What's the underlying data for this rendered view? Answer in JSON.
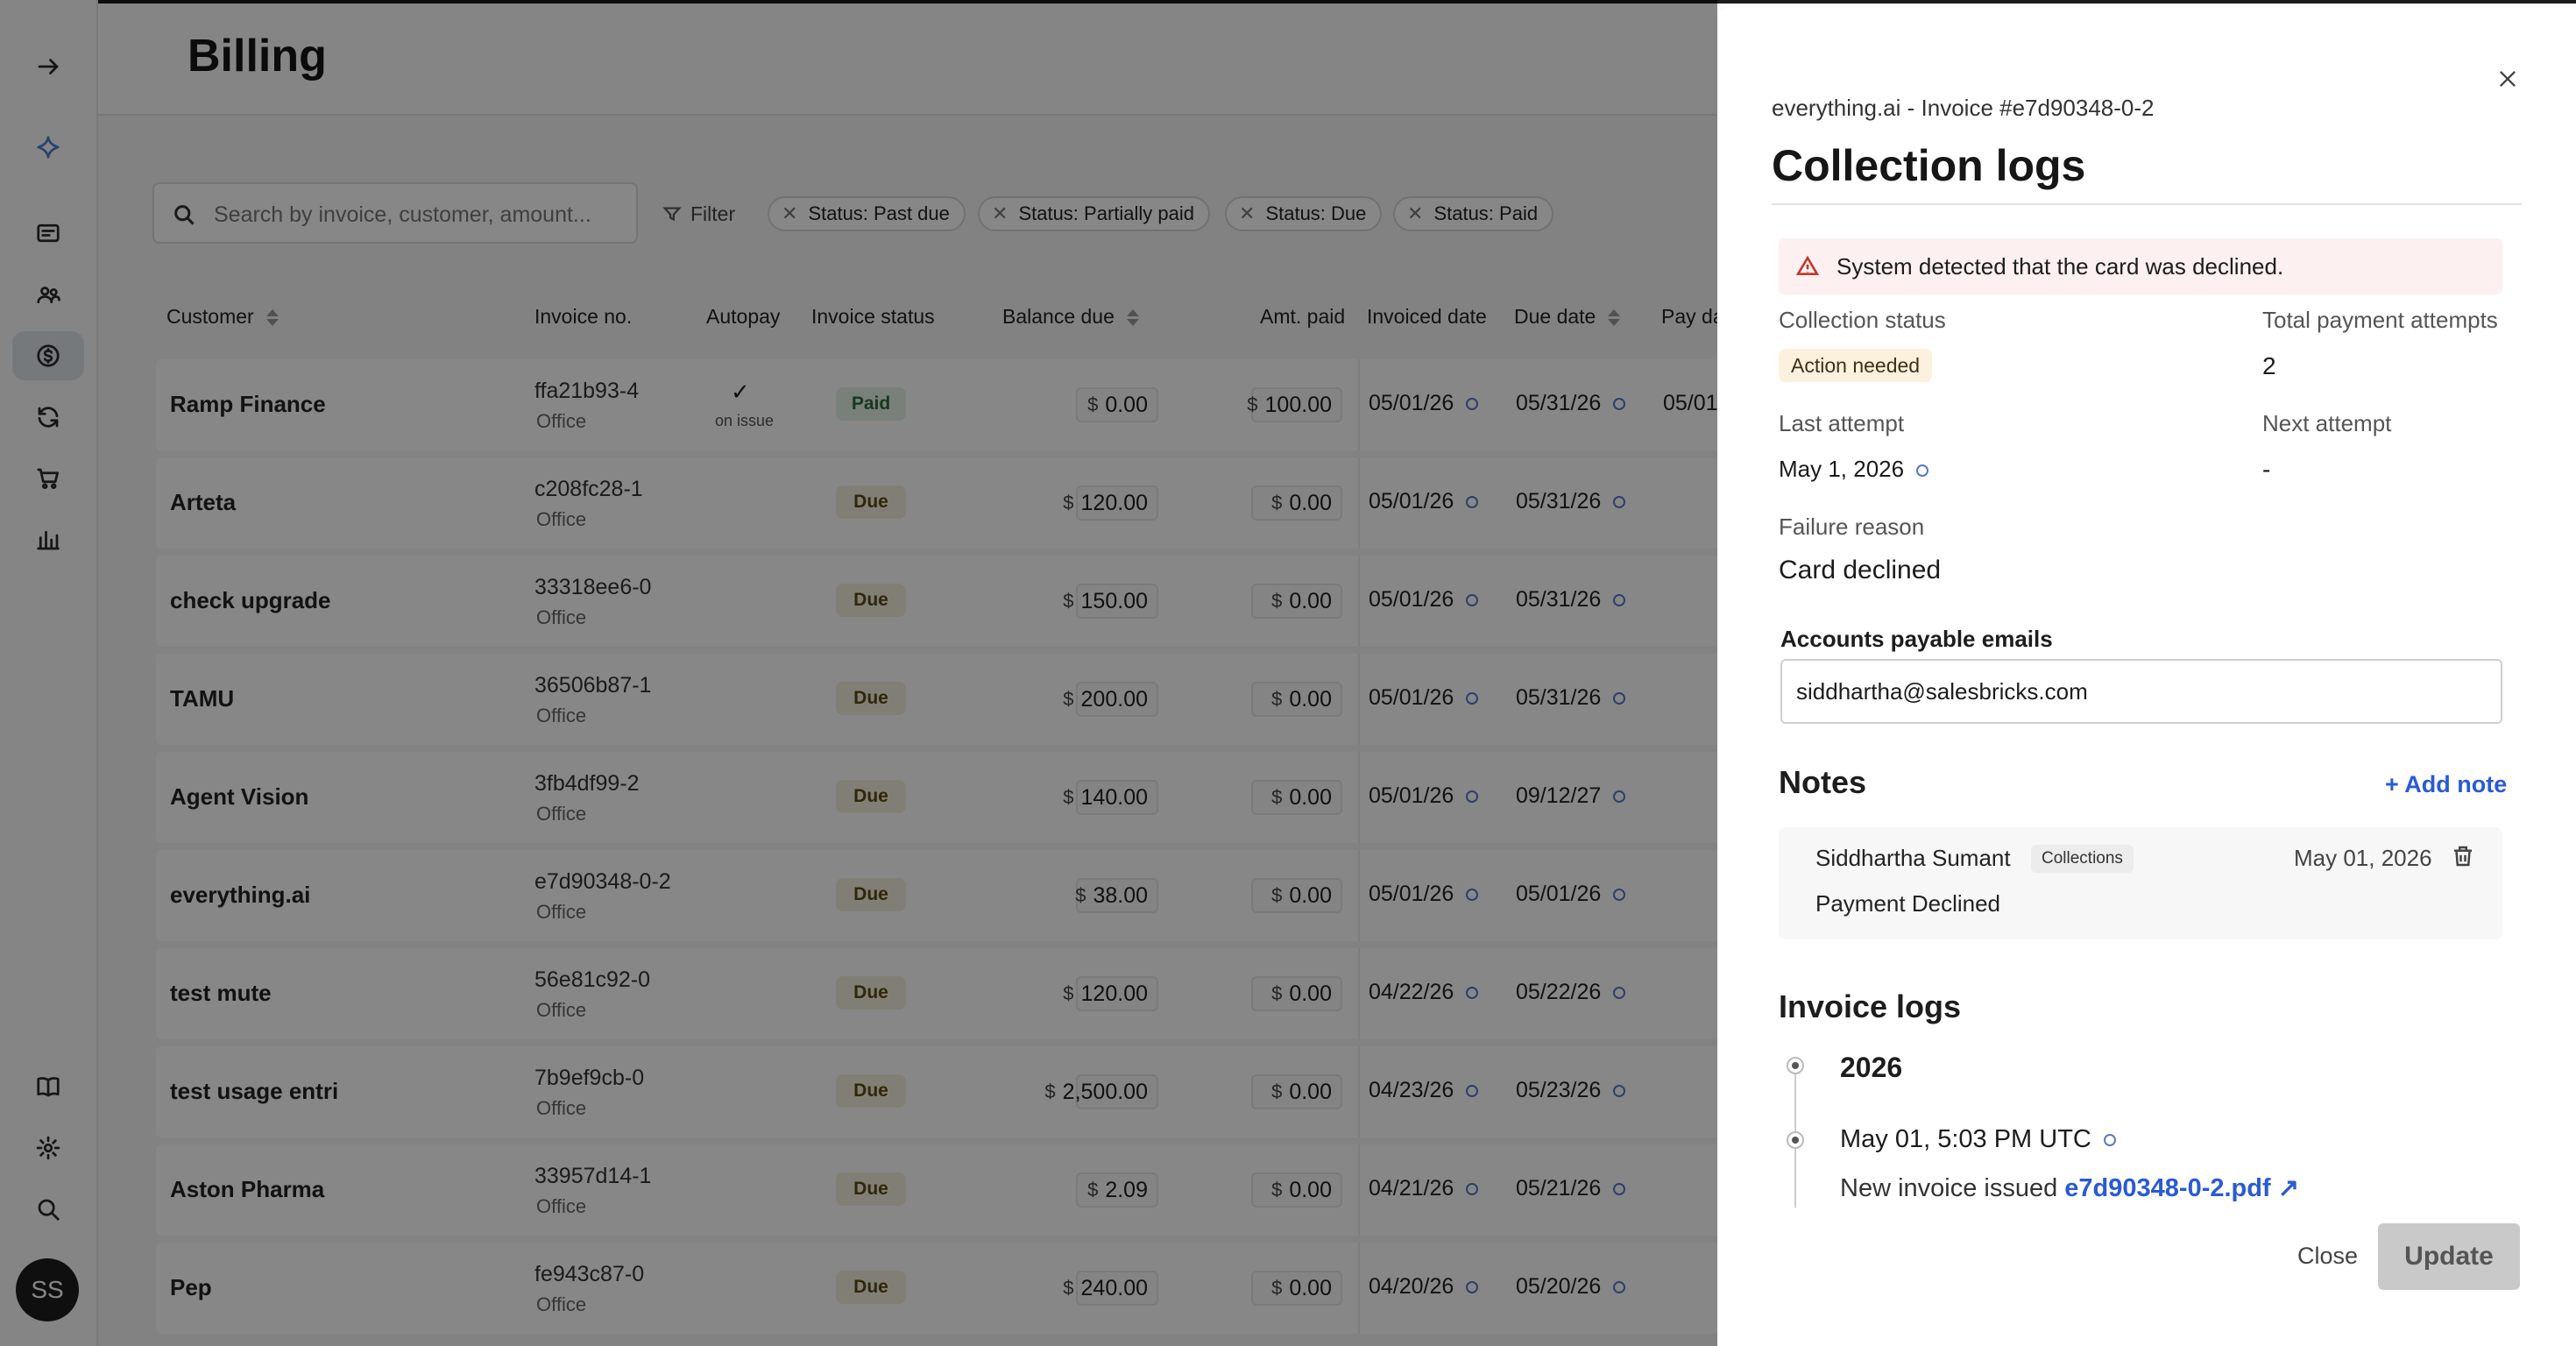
{
  "page": {
    "title": "Billing"
  },
  "search": {
    "placeholder": "Search by invoice, customer, amount..."
  },
  "filter": {
    "label": "Filter",
    "chips": [
      "Status: Past due",
      "Status: Partially paid",
      "Status: Due",
      "Status: Paid"
    ]
  },
  "table": {
    "headers": {
      "customer": "Customer",
      "invoice_no": "Invoice no.",
      "autopay": "Autopay",
      "invoice_status": "Invoice status",
      "balance_due": "Balance due",
      "amt_paid": "Amt. paid",
      "invoiced_date": "Invoiced date",
      "due_date": "Due date",
      "pay_date": "Pay da"
    },
    "currency": "$",
    "rows": [
      {
        "customer": "Ramp Finance",
        "invoice_no": "ffa21b93-4",
        "invoice_sub": "Office",
        "autopay": "on issue",
        "status": "Paid",
        "balance_due": "0.00",
        "amt_paid": "100.00",
        "invoiced_date": "05/01/26",
        "due_date": "05/31/26",
        "pay_date": "05/01"
      },
      {
        "customer": "Arteta",
        "invoice_no": "c208fc28-1",
        "invoice_sub": "Office",
        "autopay": "",
        "status": "Due",
        "balance_due": "120.00",
        "amt_paid": "0.00",
        "invoiced_date": "05/01/26",
        "due_date": "05/31/26",
        "pay_date": ""
      },
      {
        "customer": "check upgrade",
        "invoice_no": "33318ee6-0",
        "invoice_sub": "Office",
        "autopay": "",
        "status": "Due",
        "balance_due": "150.00",
        "amt_paid": "0.00",
        "invoiced_date": "05/01/26",
        "due_date": "05/31/26",
        "pay_date": ""
      },
      {
        "customer": "TAMU",
        "invoice_no": "36506b87-1",
        "invoice_sub": "Office",
        "autopay": "",
        "status": "Due",
        "balance_due": "200.00",
        "amt_paid": "0.00",
        "invoiced_date": "05/01/26",
        "due_date": "05/31/26",
        "pay_date": ""
      },
      {
        "customer": "Agent Vision",
        "invoice_no": "3fb4df99-2",
        "invoice_sub": "Office",
        "autopay": "",
        "status": "Due",
        "balance_due": "140.00",
        "amt_paid": "0.00",
        "invoiced_date": "05/01/26",
        "due_date": "09/12/27",
        "pay_date": ""
      },
      {
        "customer": "everything.ai",
        "invoice_no": "e7d90348-0-2",
        "invoice_sub": "Office",
        "autopay": "",
        "status": "Due",
        "balance_due": "38.00",
        "amt_paid": "0.00",
        "invoiced_date": "05/01/26",
        "due_date": "05/01/26",
        "pay_date": ""
      },
      {
        "customer": "test mute",
        "invoice_no": "56e81c92-0",
        "invoice_sub": "Office",
        "autopay": "",
        "status": "Due",
        "balance_due": "120.00",
        "amt_paid": "0.00",
        "invoiced_date": "04/22/26",
        "due_date": "05/22/26",
        "pay_date": ""
      },
      {
        "customer": "test usage entri",
        "invoice_no": "7b9ef9cb-0",
        "invoice_sub": "Office",
        "autopay": "",
        "status": "Due",
        "balance_due": "2,500.00",
        "amt_paid": "0.00",
        "invoiced_date": "04/23/26",
        "due_date": "05/23/26",
        "pay_date": ""
      },
      {
        "customer": "Aston Pharma",
        "invoice_no": "33957d14-1",
        "invoice_sub": "Office",
        "autopay": "",
        "status": "Due",
        "balance_due": "2.09",
        "amt_paid": "0.00",
        "invoiced_date": "04/21/26",
        "due_date": "05/21/26",
        "pay_date": ""
      },
      {
        "customer": "Pep",
        "invoice_no": "fe943c87-0",
        "invoice_sub": "Office",
        "autopay": "",
        "status": "Due",
        "balance_due": "240.00",
        "amt_paid": "0.00",
        "invoiced_date": "04/20/26",
        "due_date": "05/20/26",
        "pay_date": ""
      }
    ]
  },
  "sidebar": {
    "avatar_initials": "SS"
  },
  "panel": {
    "subtitle": "everything.ai - Invoice #e7d90348-0-2",
    "title": "Collection logs",
    "alert": "System detected that the card was declined.",
    "collection_status_label": "Collection status",
    "collection_status_value": "Action needed",
    "total_attempts_label": "Total payment attempts",
    "total_attempts_value": "2",
    "last_attempt_label": "Last attempt",
    "last_attempt_value": "May 1, 2026",
    "next_attempt_label": "Next attempt",
    "next_attempt_value": "-",
    "failure_reason_label": "Failure reason",
    "failure_reason_value": "Card declined",
    "ap_emails_label": "Accounts payable emails",
    "ap_emails_value": "siddhartha@salesbricks.com",
    "notes_title": "Notes",
    "add_note_label": "+ Add note",
    "note": {
      "author": "Siddhartha Sumant",
      "tag": "Collections",
      "date": "May 01, 2026",
      "text": "Payment Declined"
    },
    "invoice_logs_title": "Invoice logs",
    "log_year": "2026",
    "log_time": "May 01, 5:03 PM UTC",
    "log_text": "New invoice issued",
    "log_link": "e7d90348-0-2.pdf",
    "close_label": "Close",
    "update_label": "Update"
  }
}
